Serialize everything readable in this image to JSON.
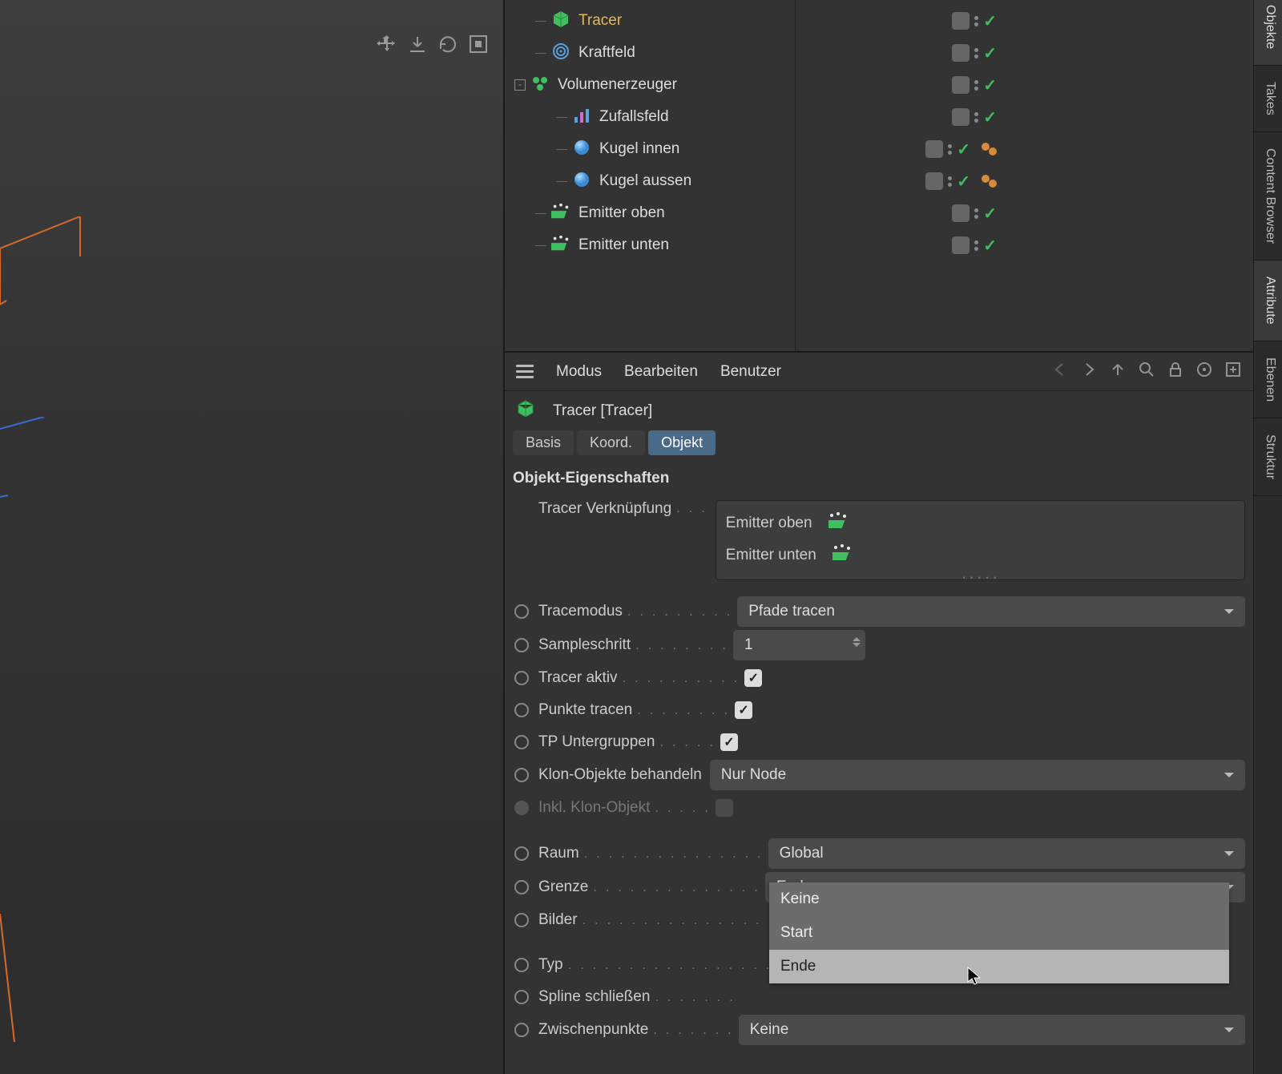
{
  "viewport": {},
  "om": {
    "items": [
      {
        "label": "Tracer",
        "icon": "cube",
        "selected": true,
        "indent": 1
      },
      {
        "label": "Kraftfeld",
        "icon": "field",
        "indent": 1
      },
      {
        "label": "Volumenerzeuger",
        "icon": "vol",
        "indent": 0,
        "expander": "-"
      },
      {
        "label": "Zufallsfeld",
        "icon": "rand",
        "indent": 2
      },
      {
        "label": "Kugel innen",
        "icon": "sphere",
        "indent": 2,
        "extra": true
      },
      {
        "label": "Kugel aussen",
        "icon": "sphere",
        "indent": 2,
        "extra": true
      },
      {
        "label": "Emitter oben",
        "icon": "emit",
        "indent": 1
      },
      {
        "label": "Emitter unten",
        "icon": "emit",
        "indent": 1
      }
    ]
  },
  "am": {
    "menus": {
      "m1": "Modus",
      "m2": "Bearbeiten",
      "m3": "Benutzer"
    },
    "title": "Tracer [Tracer]",
    "tabs": {
      "t1": "Basis",
      "t2": "Koord.",
      "t3": "Objekt"
    },
    "section": "Objekt-Eigenschaften",
    "labels": {
      "link": "Tracer Verknüpfung",
      "mode": "Tracemodus",
      "step": "Sampleschritt",
      "active": "Tracer aktiv",
      "tracepts": "Punkte tracen",
      "tpsub": "TP Untergruppen",
      "clones": "Klon-Objekte behandeln",
      "inclclone": "Inkl. Klon-Objekt",
      "space": "Raum",
      "limit": "Grenze",
      "frames": "Bilder",
      "type": "Typ",
      "close": "Spline schließen",
      "interp": "Zwischenpunkte"
    },
    "values": {
      "mode": "Pfade tracen",
      "step": "1",
      "clones": "Nur Node",
      "space": "Global",
      "limit": "Ende",
      "interp": "Keine"
    },
    "link_items": {
      "l1": "Emitter oben",
      "l2": "Emitter unten"
    },
    "dropdown": {
      "opt1": "Keine",
      "opt2": "Start",
      "opt3": "Ende"
    }
  },
  "vtabs": {
    "t0": "Objekte",
    "t1": "Takes",
    "t2": "Content Browser",
    "t3": "Attribute",
    "t4": "Ebenen",
    "t5": "Struktur"
  }
}
